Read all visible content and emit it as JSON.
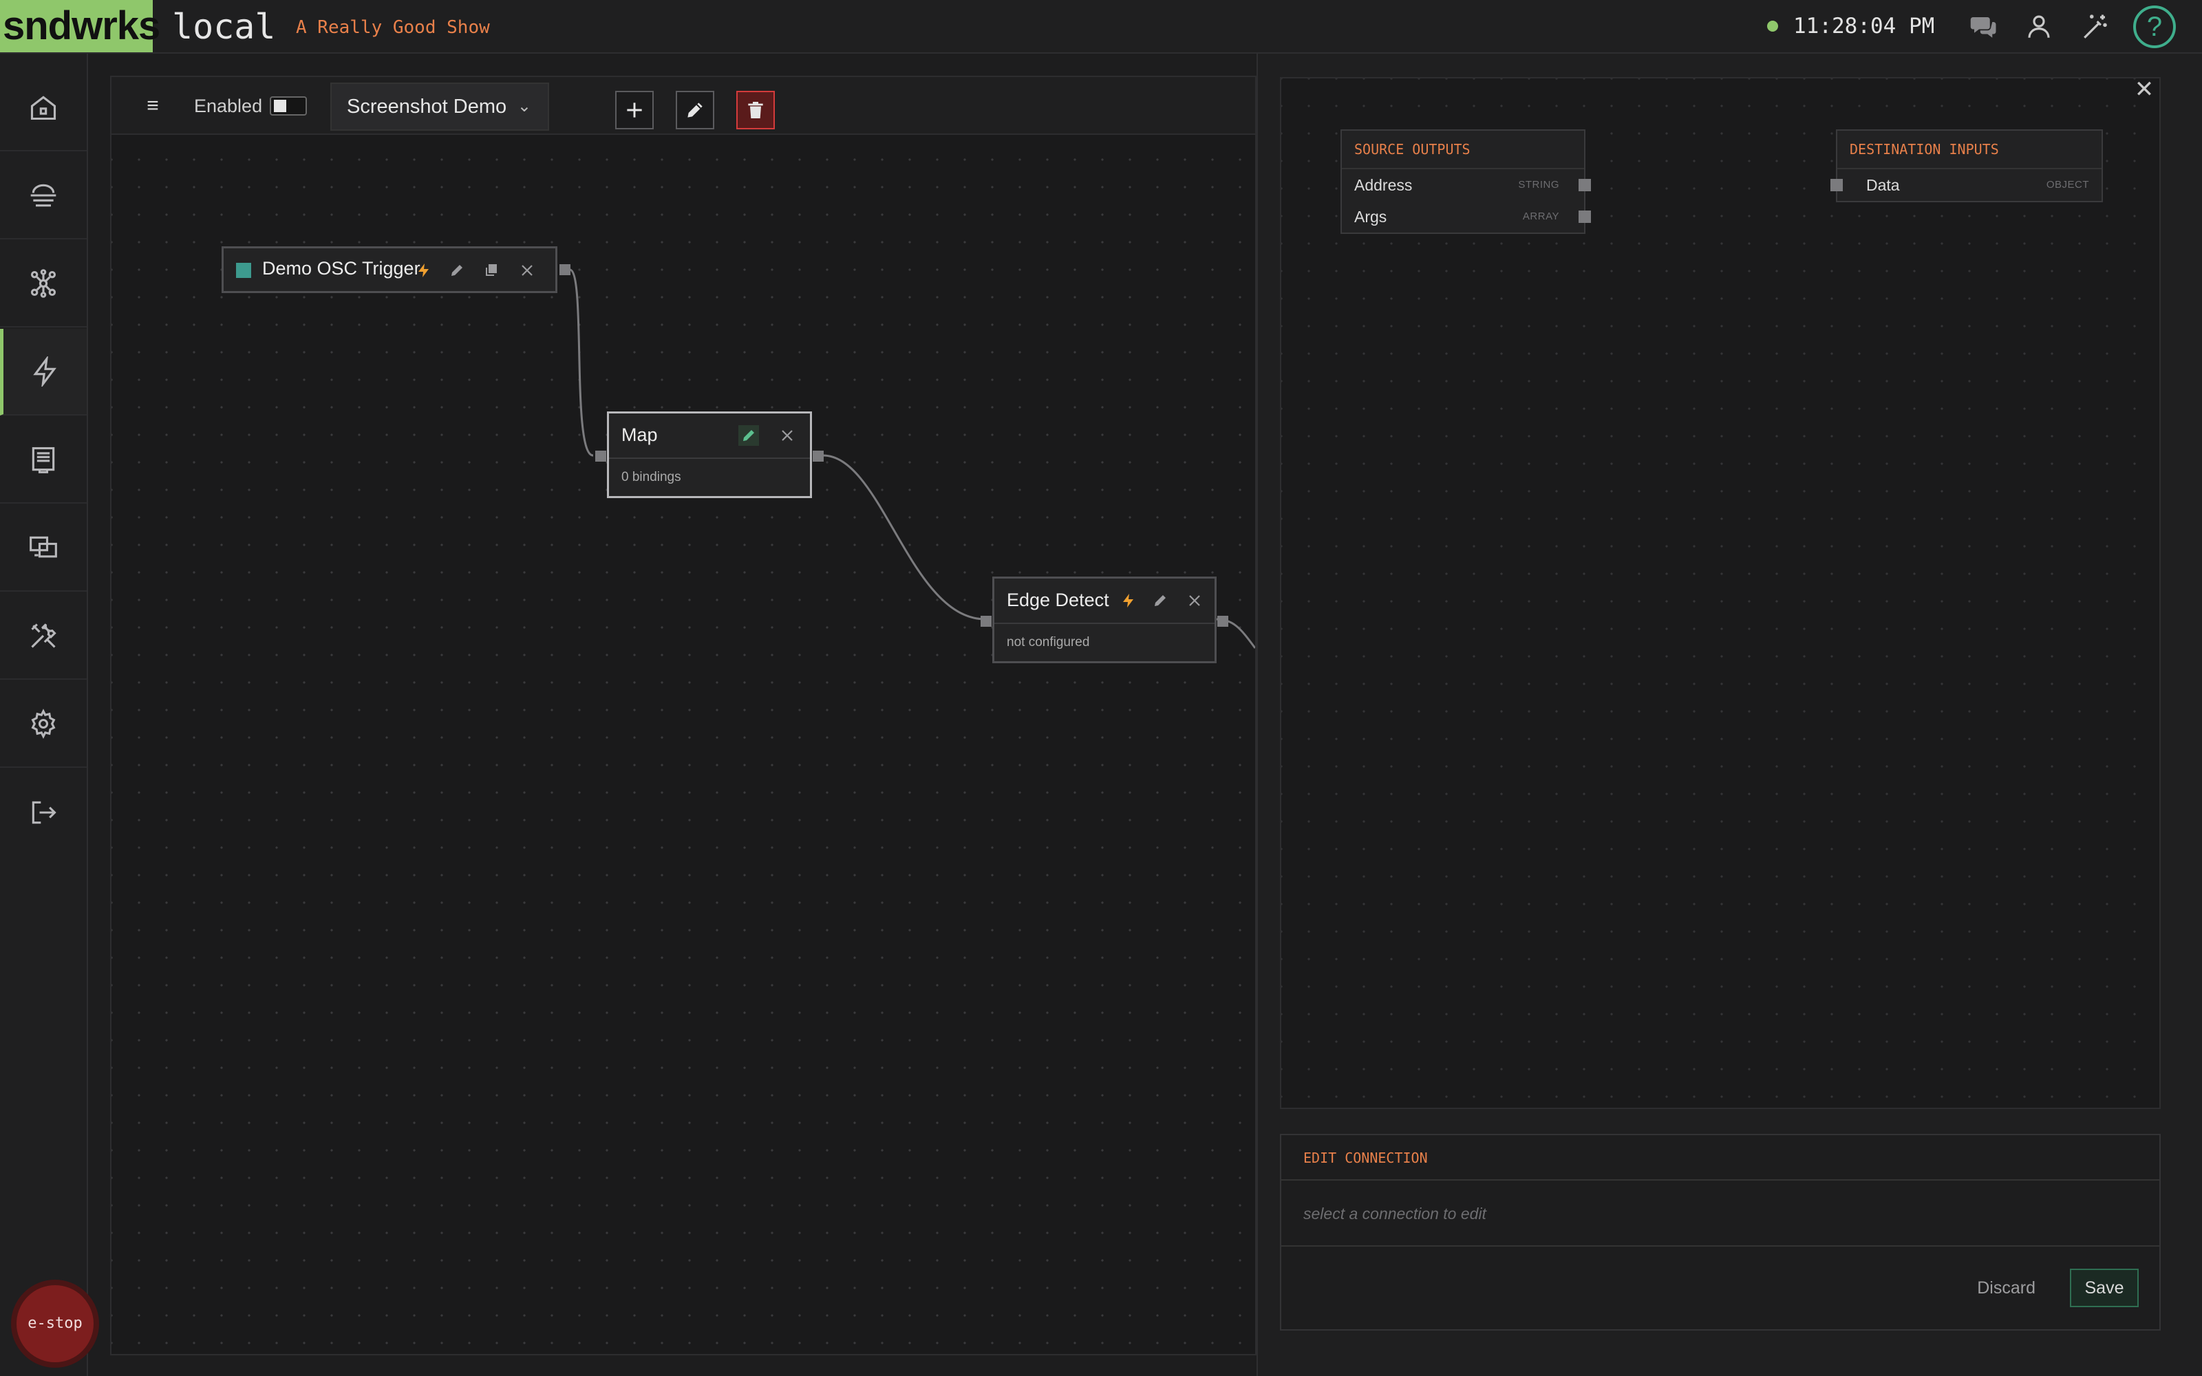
{
  "topbar": {
    "logo": "sndwrks",
    "host": "local",
    "show_name": "A Really Good Show",
    "clock": "11:28:04 PM",
    "status_color": "#8fc76b",
    "icons": [
      "chat-icon",
      "user-icon",
      "magic-wand-icon"
    ],
    "help": "?"
  },
  "sidebar": {
    "items": [
      {
        "icon": "home-icon"
      },
      {
        "icon": "network-icon"
      },
      {
        "icon": "nodes-icon"
      },
      {
        "icon": "lightning-icon",
        "active": true
      },
      {
        "icon": "panel-icon"
      },
      {
        "icon": "screens-icon"
      },
      {
        "icon": "tools-icon"
      },
      {
        "icon": "gear-icon"
      },
      {
        "icon": "logout-icon"
      }
    ],
    "estop": "e-stop"
  },
  "toolbar": {
    "menu_icon": "≡",
    "enabled_label": "Enabled",
    "enabled": false,
    "flow_name": "Screenshot Demo",
    "buttons": [
      "add-icon",
      "edit-icon",
      "trash-icon"
    ]
  },
  "nodes": {
    "trigger": {
      "title": "Demo OSC Trigger",
      "color": "#3d9a8e"
    },
    "map": {
      "title": "Map",
      "subtitle": "0 bindings"
    },
    "edge": {
      "title": "Edge Detect",
      "subtitle": "not configured"
    }
  },
  "mapping": {
    "source": {
      "heading": "SOURCE OUTPUTS",
      "rows": [
        {
          "label": "Address",
          "type": "STRING"
        },
        {
          "label": "Args",
          "type": "ARRAY"
        }
      ]
    },
    "destination": {
      "heading": "DESTINATION INPUTS",
      "rows": [
        {
          "label": "Data",
          "type": "OBJECT"
        }
      ]
    }
  },
  "edit_connection": {
    "heading": "EDIT CONNECTION",
    "hint": "select a connection to edit",
    "discard": "Discard",
    "save": "Save"
  },
  "colors": {
    "accent_green": "#8fc76b",
    "accent_orange": "#e8804a",
    "lightning": "#f0a030",
    "danger": "#d43b3b",
    "help": "#3fae8c"
  }
}
